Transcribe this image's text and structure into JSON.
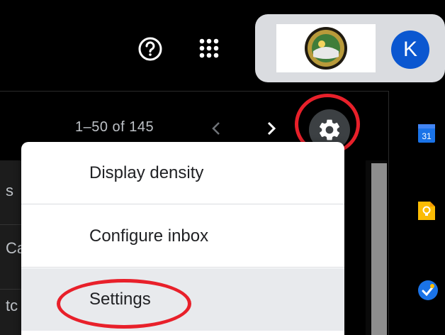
{
  "header": {
    "help_icon": "help-circle-icon",
    "apps_icon": "apps-grid-icon",
    "avatar_letter": "K"
  },
  "toolbar": {
    "pagination": "1–50 of 145",
    "prev_label": "‹",
    "next_label": "›"
  },
  "list_rows": [
    {
      "text": "s"
    },
    {
      "text": "Ca"
    },
    {
      "text": "tc"
    }
  ],
  "settings_menu": {
    "items": [
      {
        "label": "Display density"
      },
      {
        "label": "Configure inbox"
      },
      {
        "label": "Settings"
      }
    ]
  },
  "side_panel": {
    "calendar_day": "31"
  },
  "colors": {
    "highlight_ring": "#e8202a",
    "avatar_bg": "#0b57d0",
    "background": "#000000",
    "menu_bg": "#ffffff"
  }
}
